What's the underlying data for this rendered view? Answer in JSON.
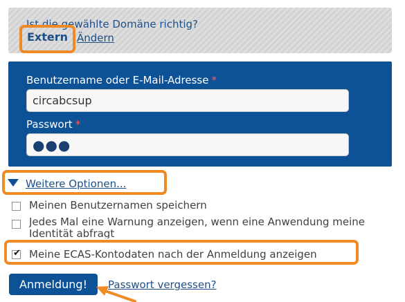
{
  "domain": {
    "question": "Ist die gewählte Domäne richtig?",
    "value": "Extern",
    "change_link": "Ändern"
  },
  "form": {
    "username_label": "Benutzername oder E-Mail-Adresse",
    "username_value": "circabcsup",
    "password_label": "Passwort",
    "password_value": "●●●",
    "required_marker": "*"
  },
  "options": {
    "more_options_link": "Weitere Optionen...",
    "remember_username": {
      "label": "Meinen Benutzernamen speichern",
      "checked": false
    },
    "warn_each_time": {
      "label": "Jedes Mal eine Warnung anzeigen, wenn eine Anwendung meine Identität abfragt",
      "checked": false
    },
    "show_account_data": {
      "label": "Meine ECAS-Kontodaten nach der Anmeldung anzeigen",
      "checked": true
    }
  },
  "actions": {
    "login_button": "Anmeldung!",
    "forgot_password": "Passwort vergessen?"
  },
  "colors": {
    "panel_blue": "#0d5297",
    "highlight_orange": "#f08a24",
    "link_blue": "#1f4f87",
    "required_red": "#ff5a5a"
  }
}
